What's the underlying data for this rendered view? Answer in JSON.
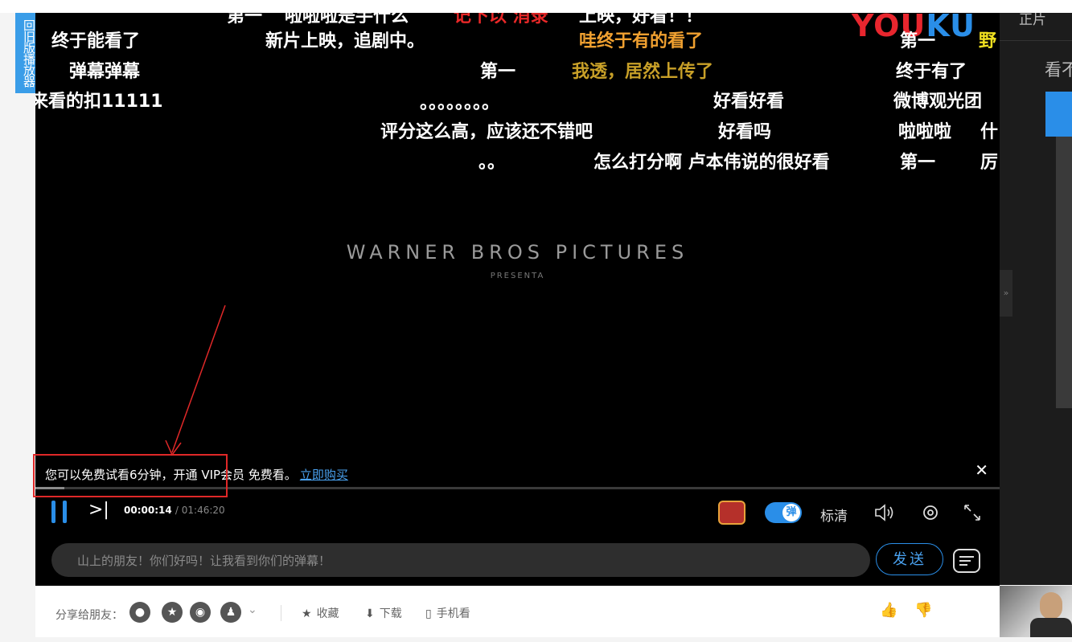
{
  "old_player_label": "回旧版播放器",
  "logo": {
    "part1": "YOU",
    "part2": "KU"
  },
  "danmaku": [
    {
      "text": "第一",
      "color": "#ffffff"
    },
    {
      "text": "啦啦啦是手什么",
      "color": "#ffffff"
    },
    {
      "text": "记下以 消录",
      "color": "#e82828"
    },
    {
      "text": "上映，好看！！",
      "color": "#ffffff"
    },
    {
      "text": "终于能看了",
      "color": "#ffffff"
    },
    {
      "text": "新片上映，追剧中。",
      "color": "#ffffff"
    },
    {
      "text": "哇终于有的看了",
      "color": "#f0a030"
    },
    {
      "text": "第一",
      "color": "#ffffff"
    },
    {
      "text": "野",
      "color": "#f0e020"
    },
    {
      "text": "弹幕弹幕",
      "color": "#ffffff"
    },
    {
      "text": "第一",
      "color": "#ffffff"
    },
    {
      "text": "我透，居然上传了",
      "color": "#c8a028"
    },
    {
      "text": "终于有了",
      "color": "#ffffff"
    },
    {
      "text": "来看的扣11111",
      "color": "#ffffff"
    },
    {
      "text": "。。。。。。。。",
      "color": "#ffffff"
    },
    {
      "text": "好看好看",
      "color": "#ffffff"
    },
    {
      "text": "微博观光团",
      "color": "#ffffff"
    },
    {
      "text": "评分这么高，应该还不错吧",
      "color": "#ffffff"
    },
    {
      "text": "好看吗",
      "color": "#ffffff"
    },
    {
      "text": "啦啦啦",
      "color": "#ffffff"
    },
    {
      "text": "什",
      "color": "#ffffff"
    },
    {
      "text": "。。",
      "color": "#ffffff"
    },
    {
      "text": "怎么打分啊 卢本伟说的很好看",
      "color": "#ffffff"
    },
    {
      "text": "第一",
      "color": "#ffffff"
    },
    {
      "text": "厉",
      "color": "#ffffff"
    }
  ],
  "video": {
    "studio": "WARNER BROS PICTURES",
    "studio_sub": "PRESENTA"
  },
  "trial": {
    "message": "您可以免费试看6分钟，开通 VIP会员 免费看。",
    "link": "立即购买",
    "close": "✕"
  },
  "player": {
    "progress_fraction": 0.03,
    "current_time": "00:00:14",
    "total_time": "01:46:20",
    "danmaku_toggle_label": "弹",
    "quality": "标清",
    "input_placeholder": "山上的朋友！你们好吗！让我看到你们的弹幕！",
    "send_label": "发送"
  },
  "right_panel": {
    "tab1": "正片",
    "tab2": "看不"
  },
  "share": {
    "label": "分享给朋友：",
    "actions": {
      "favorite": "收藏",
      "download": "下载",
      "mobile": "手机看"
    }
  },
  "colors": {
    "accent": "#2a8ee8",
    "highlight": "#e02828"
  }
}
